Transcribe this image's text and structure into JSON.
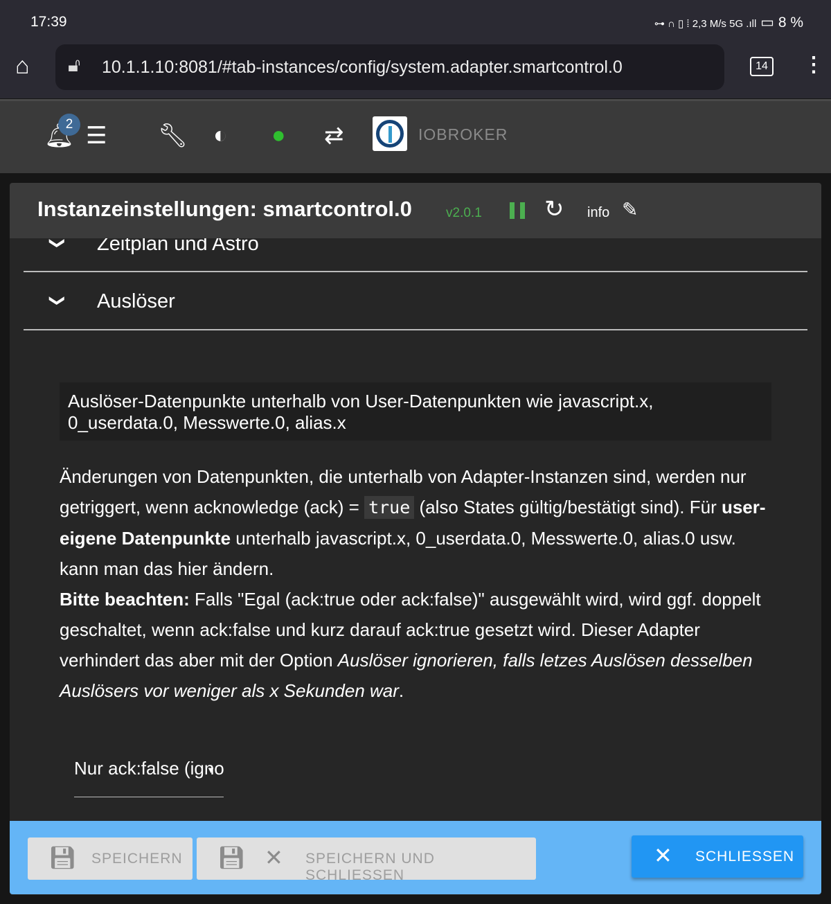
{
  "status": {
    "time": "17:39",
    "indicators": "⊶ ∩ ▯ ⁞ 2,3 M/s 5G .ıll",
    "battery": "8 %"
  },
  "browser": {
    "url": "10.1.1.10:8081/#tab-instances/config/system.adapter.smartcontrol.0",
    "tab_count": "14"
  },
  "appbar": {
    "notification_count": "2",
    "brand": "IOBROKER",
    "icons": [
      "bell-icon",
      "menu-icon",
      "wrench-icon",
      "theme-icon",
      "expert-mode-icon",
      "sync-off-icon",
      "iobroker-logo"
    ]
  },
  "dialog": {
    "title": "Instanzeinstellungen: smartcontrol.0",
    "version": "v2.0.1",
    "info_label": "info",
    "sections": [
      {
        "title": "Zeitplan und Astro"
      },
      {
        "title": "Auslöser"
      }
    ],
    "note": "Auslöser-Datenpunkte unterhalb von User-Datenpunkten wie javascript.x, 0_userdata.0, Messwerte.0, alias.x",
    "para": {
      "p1": "Änderungen von Datenpunkten, die unterhalb von Adapter-Instanzen sind, werden nur getriggert, wenn acknowledge (ack) = ",
      "code": "true",
      "p2": " (also States gültig/bestätigt sind). Für ",
      "bold1": "user-eigene Datenpunkte",
      "p3": " unterhalb javascript.x, 0_userdata.0, Messwerte.0, alias.0 usw. kann man das hier ändern.",
      "bold2": "Bitte beachten:",
      "p4": " Falls \"Egal (ack:true oder ack:false)\" ausgewählt wird, wird ggf. doppelt geschaltet, wenn ack:false und kurz darauf ack:true gesetzt wird. Dieser Adapter verhindert das aber mit der Option ",
      "italic": "Auslöser ignorieren, falls letzes Auslösen desselben Auslösers vor weniger als x Sekunden war",
      "p5": "."
    },
    "select_value": "Nur ack:false (ignoriert)",
    "footer": {
      "save": "SPEICHERN",
      "save_close": "SPEICHERN UND SCHLIESSEN",
      "close": "SCHLIESSEN"
    }
  }
}
